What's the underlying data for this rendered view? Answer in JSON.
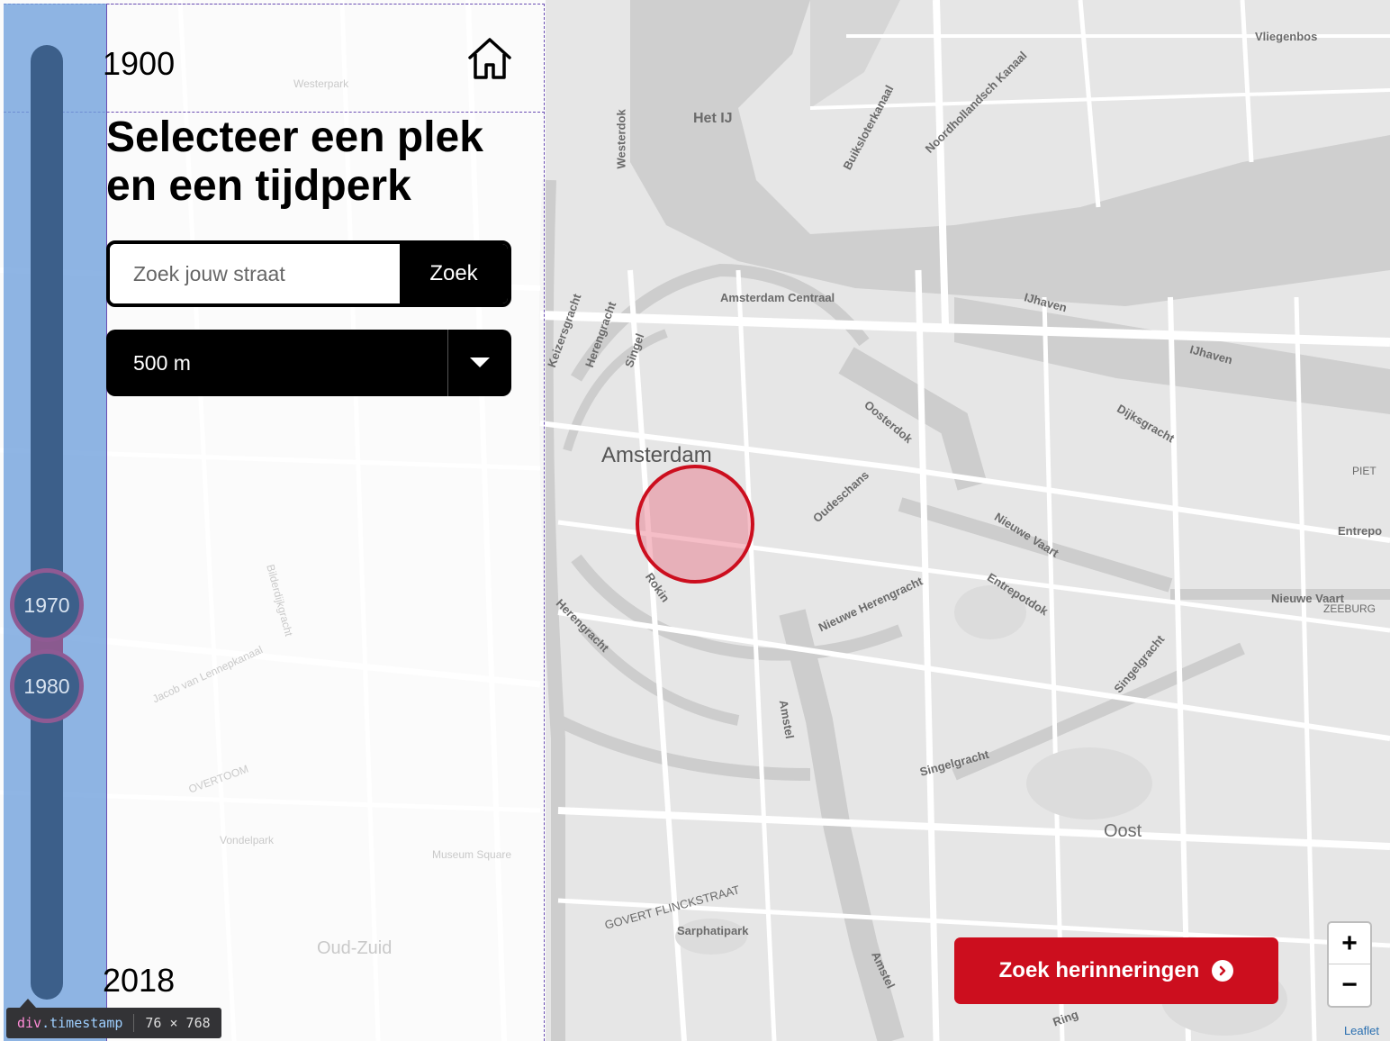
{
  "header": {
    "year_top": "1900",
    "year_bottom": "2018",
    "home_icon": "home-icon"
  },
  "main": {
    "title": "Selecteer een plek en een tijdperk",
    "search": {
      "placeholder": "Zoek jouw straat",
      "value": "",
      "button_label": "Zoek"
    },
    "radius": {
      "selected": "500 m",
      "arrow_icon": "caret-down-icon"
    }
  },
  "timeline": {
    "start_label": "1970",
    "end_label": "1980"
  },
  "map": {
    "labels": {
      "vliegenbos": "Vliegenbos",
      "het_ij": "Het IJ",
      "westerdok": "Westerdok",
      "buiksloterkanaal": "Buiksloterkanaal",
      "noordhollandsch": "Noordhollandsch Kanaal",
      "centraal": "Amsterdam Centraal",
      "ijhaven_1": "IJhaven",
      "ijhaven_2": "IJhaven",
      "oosterdok": "Oosterdok",
      "dijksgracht": "Dijksgracht",
      "amsterdam": "Amsterdam",
      "oudeschans": "Oudeschans",
      "nieuwe_vaart_1": "Nieuwe Vaart",
      "nieuwe_vaart_2": "Nieuwe Vaart",
      "entrepotdok": "Entrepotdok",
      "entrepo": "Entrepo",
      "piet": "PIET",
      "zeeburg": "ZEEBURG",
      "rokin": "Rokin",
      "herengracht": "Herengracht",
      "nieuwe_herengracht": "Nieuwe Herengracht",
      "singelgracht_1": "Singelgracht",
      "singelgracht_2": "Singelgracht",
      "amstel_1": "Amstel",
      "amstel_2": "Amstel",
      "oost": "Oost",
      "govert": "GOVERT FLINCKSTRAAT",
      "sarphatipark": "Sarphatipark",
      "oud_zuid": "Oud-Zuid",
      "keizersgracht": "Keizersgracht",
      "herengracht_n": "Herengracht",
      "singel": "Singel",
      "ring": "Ring",
      "westerpark": "Westerpark",
      "vondelpark": "Vondelpark",
      "overtoom": "OVERTOOM",
      "museum_square": "Museum Square",
      "bilderdijkgracht": "Bilderdijkgracht",
      "jacob": "Jacob van Lennepkanaal"
    },
    "radius_marker": {
      "fill": "#e86e82",
      "stroke": "#cc0e1e"
    }
  },
  "actions": {
    "find_label": "Zoek herinneringen",
    "find_icon": "chevron-circle-right-icon"
  },
  "zoom": {
    "in_label": "+",
    "out_label": "−"
  },
  "attribution": "Leaflet",
  "devtools": {
    "selector_tag": "div",
    "selector_class": ".timestamp",
    "size": "76 × 768"
  },
  "colors": {
    "accent": "#cc0e1e",
    "slider": "#3c5f8a",
    "handle_border": "#8f5a93"
  }
}
